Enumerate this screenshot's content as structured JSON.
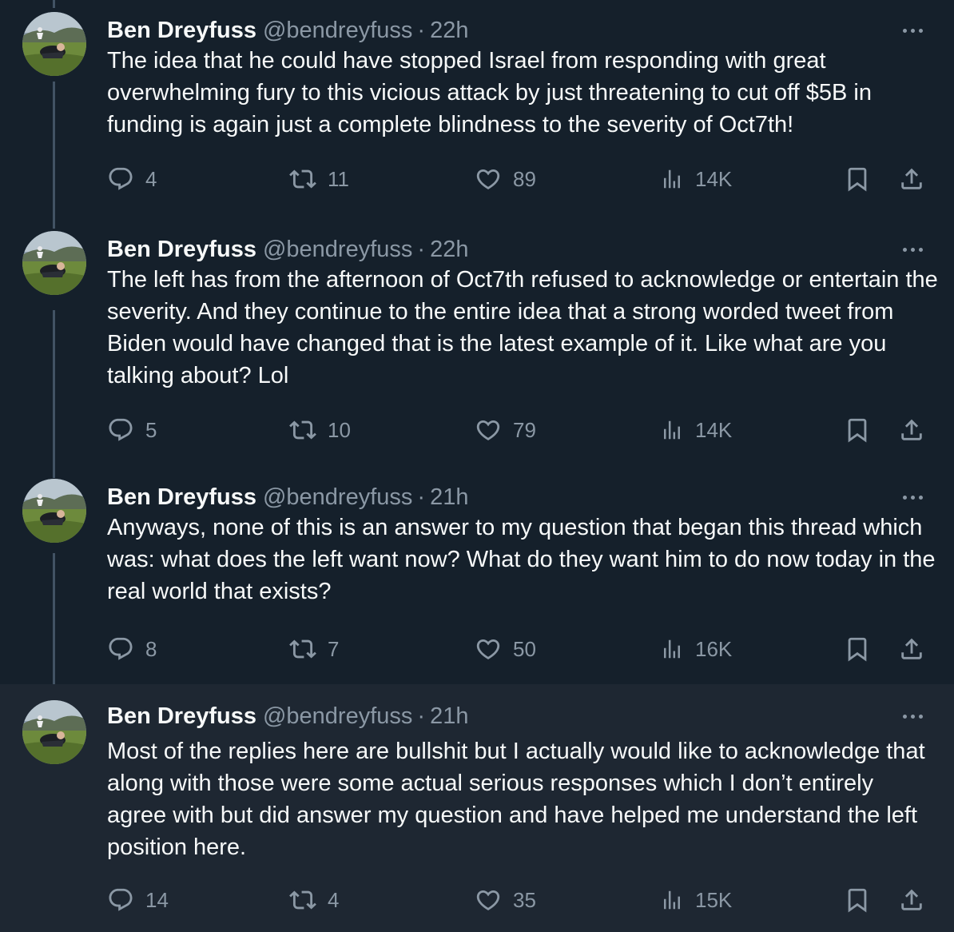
{
  "colors": {
    "background": "#15202b",
    "highlight_background": "#1e2732",
    "text": "#f7f9f9",
    "muted": "#8b98a5",
    "thread_line": "#425364"
  },
  "tweets": [
    {
      "name": "Ben Dreyfuss",
      "handle": "@bendreyfuss",
      "dot": "·",
      "time": "22h",
      "text": "The idea that he could have stopped Israel from responding with great overwhelming fury to this vicious attack by just threatening to cut off $5B in funding is again just a complete blindness to the severity of Oct7th!",
      "replies": "4",
      "retweets": "11",
      "likes": "89",
      "views": "14K",
      "icons": {
        "reply": "reply-icon",
        "retweet": "retweet-icon",
        "like": "heart-icon",
        "views": "views-icon",
        "bookmark": "bookmark-icon",
        "share": "share-icon",
        "more": "more-icon"
      }
    },
    {
      "name": "Ben Dreyfuss",
      "handle": "@bendreyfuss",
      "dot": "·",
      "time": "22h",
      "text": "The left has from the afternoon of Oct7th refused to acknowledge or entertain the severity. And they continue to the entire idea that a strong worded tweet from Biden would have changed that is the latest example of it. Like what are you talking about? Lol",
      "replies": "5",
      "retweets": "10",
      "likes": "79",
      "views": "14K"
    },
    {
      "name": "Ben Dreyfuss",
      "handle": "@bendreyfuss",
      "dot": "·",
      "time": "21h",
      "text": "Anyways, none of this is an answer to my question that began this thread which was: what does the left want now? What do they want him to do now today in the real world that exists?",
      "replies": "8",
      "retweets": "7",
      "likes": "50",
      "views": "16K"
    },
    {
      "name": "Ben Dreyfuss",
      "handle": "@bendreyfuss",
      "dot": "·",
      "time": "21h",
      "text": "Most of the replies here are bullshit but I actually would like to acknowledge that along with those were some actual serious responses which I don’t entirely agree with but did answer my question and have helped me understand the left position here.",
      "replies": "14",
      "retweets": "4",
      "likes": "35",
      "views": "15K"
    }
  ]
}
